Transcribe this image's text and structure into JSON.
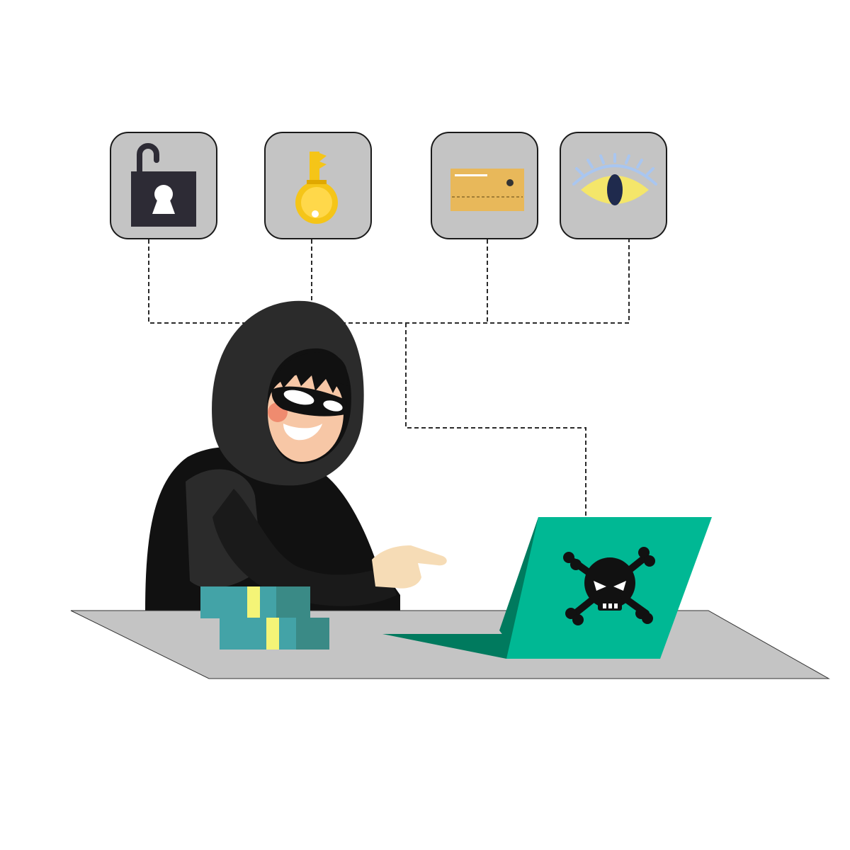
{
  "scene": {
    "subject": "hooded-hacker",
    "icons": [
      {
        "name": "unlocked-padlock-icon"
      },
      {
        "name": "key-icon"
      },
      {
        "name": "credit-card-icon"
      },
      {
        "name": "eye-icon"
      }
    ],
    "laptop_emblem": "skull-and-crossbones-icon"
  },
  "colors": {
    "background": "#ffffff",
    "tile_fill": "#c4c4c4",
    "tile_border": "#1a1a1a",
    "desk": "#c4c4c4",
    "hoodie_dark": "#2b2b2b",
    "hoodie_black": "#111111",
    "laptop_lid": "#00b894",
    "laptop_base": "#007a5e",
    "cash_teal": "#43a3a7",
    "cash_band": "#f4f477",
    "key_gold": "#f5c518",
    "card_tan": "#e8b85a",
    "eye_yellow": "#f4e66a",
    "eye_pupil": "#1f2a4d",
    "lashes": "#a9c6f0",
    "skin": "#f7c7a6",
    "hand": "#f6dcb6"
  }
}
